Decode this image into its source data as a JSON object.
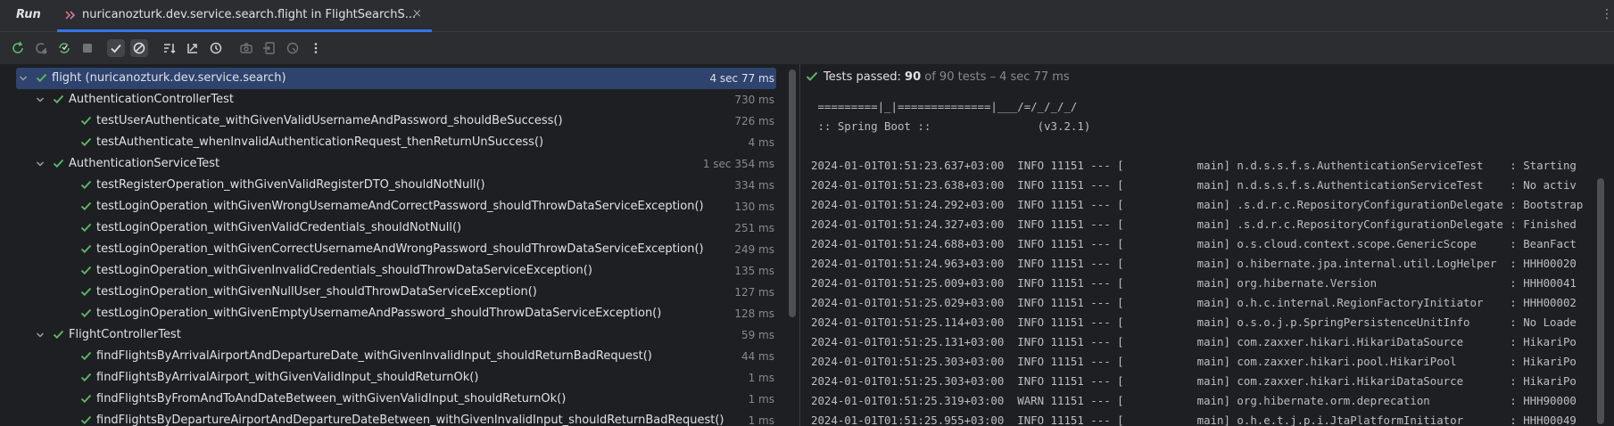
{
  "window": {
    "tool_title": "Run",
    "tab_label": "nuricanozturk.dev.service.search.flight in FlightSearchS...",
    "tab_close": "×",
    "more": "⋮"
  },
  "colors": {
    "accent": "#3574f0",
    "pass": "#5fb865",
    "selection": "#2e436e"
  },
  "toolbar": {
    "icons": [
      "rerun-icon",
      "rerun-failed-icon",
      "toggle-auto-test-icon",
      "stop-icon",
      "show-passed-icon",
      "show-ignored-icon",
      "sort-alphabetically-icon",
      "sort-by-duration-icon",
      "history-icon",
      "screenshot-icon",
      "import-tests-icon",
      "export-tests-icon",
      "more-icon"
    ]
  },
  "tree": {
    "rows": [
      {
        "name": "flight (nuricanozturk.dev.service.search)",
        "duration": "4 sec 77 ms",
        "level": 0,
        "expandable": true
      },
      {
        "name": "AuthenticationControllerTest",
        "duration": "730 ms",
        "level": 1,
        "expandable": true
      },
      {
        "name": "testUserAuthenticate_withGivenValidUsernameAndPassword_shouldBeSuccess()",
        "duration": "726 ms",
        "level": 2,
        "expandable": false
      },
      {
        "name": "testAuthenticate_whenInvalidAuthenticationRequest_thenReturnUnSuccess()",
        "duration": "4 ms",
        "level": 2,
        "expandable": false
      },
      {
        "name": "AuthenticationServiceTest",
        "duration": "1 sec 354 ms",
        "level": 1,
        "expandable": true
      },
      {
        "name": "testRegisterOperation_withGivenValidRegisterDTO_shouldNotNull()",
        "duration": "334 ms",
        "level": 2,
        "expandable": false
      },
      {
        "name": "testLoginOperation_withGivenWrongUsernameAndCorrectPassword_shouldThrowDataServiceException()",
        "duration": "130 ms",
        "level": 2,
        "expandable": false
      },
      {
        "name": "testLoginOperation_withGivenValidCredentials_shouldNotNull()",
        "duration": "251 ms",
        "level": 2,
        "expandable": false
      },
      {
        "name": "testLoginOperation_withGivenCorrectUsernameAndWrongPassword_shouldThrowDataServiceException()",
        "duration": "249 ms",
        "level": 2,
        "expandable": false
      },
      {
        "name": "testLoginOperation_withGivenInvalidCredentials_shouldThrowDataServiceException()",
        "duration": "135 ms",
        "level": 2,
        "expandable": false
      },
      {
        "name": "testLoginOperation_withGivenNullUser_shouldThrowDataServiceException()",
        "duration": "127 ms",
        "level": 2,
        "expandable": false
      },
      {
        "name": "testLoginOperation_withGivenEmptyUsernameAndPassword_shouldThrowDataServiceException()",
        "duration": "128 ms",
        "level": 2,
        "expandable": false
      },
      {
        "name": "FlightControllerTest",
        "duration": "59 ms",
        "level": 1,
        "expandable": true
      },
      {
        "name": "findFlightsByArrivalAirportAndDepartureDate_withGivenInvalidInput_shouldReturnBadRequest()",
        "duration": "44 ms",
        "level": 2,
        "expandable": false
      },
      {
        "name": "findFlightsByArrivalAirport_withGivenValidInput_shouldReturnOk()",
        "duration": "1 ms",
        "level": 2,
        "expandable": false
      },
      {
        "name": "findFlightsByFromAndToAndDateBetween_withGivenValidInput_shouldReturnOk()",
        "duration": "1 ms",
        "level": 2,
        "expandable": false
      },
      {
        "name": "findFlightsByDepartureAirportAndDepartureDateBetween_withGivenInvalidInput_shouldReturnBadRequest()",
        "duration": "1 ms",
        "level": 2,
        "expandable": false
      }
    ]
  },
  "console": {
    "status_label": "Tests passed: ",
    "passed_count": "90",
    "status_rest": " of 90 tests – 4 sec 77 ms",
    "lines": [
      " =========|_|==============|___/=/_/_/_/",
      " :: Spring Boot ::                (v3.2.1)",
      "",
      "2024-01-01T01:51:23.637+03:00  INFO 11151 --- [           main] n.d.s.s.f.s.AuthenticationServiceTest    : Starting",
      "2024-01-01T01:51:23.638+03:00  INFO 11151 --- [           main] n.d.s.s.f.s.AuthenticationServiceTest    : No activ",
      "2024-01-01T01:51:24.292+03:00  INFO 11151 --- [           main] .s.d.r.c.RepositoryConfigurationDelegate : Bootstrap",
      "2024-01-01T01:51:24.327+03:00  INFO 11151 --- [           main] .s.d.r.c.RepositoryConfigurationDelegate : Finished",
      "2024-01-01T01:51:24.688+03:00  INFO 11151 --- [           main] o.s.cloud.context.scope.GenericScope     : BeanFact",
      "2024-01-01T01:51:24.963+03:00  INFO 11151 --- [           main] o.hibernate.jpa.internal.util.LogHelper  : HHH00020",
      "2024-01-01T01:51:25.009+03:00  INFO 11151 --- [           main] org.hibernate.Version                    : HHH00041",
      "2024-01-01T01:51:25.029+03:00  INFO 11151 --- [           main] o.h.c.internal.RegionFactoryInitiator    : HHH00002",
      "2024-01-01T01:51:25.114+03:00  INFO 11151 --- [           main] o.s.o.j.p.SpringPersistenceUnitInfo      : No Loade",
      "2024-01-01T01:51:25.131+03:00  INFO 11151 --- [           main] com.zaxxer.hikari.HikariDataSource       : HikariPo",
      "2024-01-01T01:51:25.303+03:00  INFO 11151 --- [           main] com.zaxxer.hikari.pool.HikariPool        : HikariPo",
      "2024-01-01T01:51:25.303+03:00  INFO 11151 --- [           main] com.zaxxer.hikari.HikariDataSource       : HikariPo",
      "2024-01-01T01:51:25.319+03:00  WARN 11151 --- [           main] org.hibernate.orm.deprecation            : HHH90000",
      "2024-01-01T01:51:25.955+03:00  INFO 11151 --- [           main] o.h.e.t.j.p.i.JtaPlatformInitiator       : HHH00049"
    ]
  }
}
